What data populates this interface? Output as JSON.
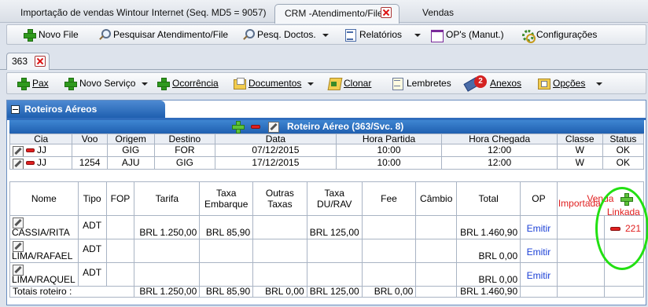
{
  "main_tabs": [
    {
      "label": "Importação de vendas Wintour Internet (Seq. MD5 = 9057)"
    },
    {
      "label": "CRM -Atendimento/File"
    },
    {
      "label": "Vendas"
    }
  ],
  "toolbar1": {
    "novo_file": "Novo File",
    "pesquisar": "Pesquisar Atendimento/File",
    "pesq_doctos": "Pesq. Doctos.",
    "relatorios": "Relatórios",
    "ops": "OP's (Manut.)",
    "configuracoes": "Configurações"
  },
  "inner_tab": {
    "label": "363"
  },
  "toolbar2": {
    "pax": "Pax",
    "novo_servico": "Novo Serviço",
    "ocorrencia": "Ocorrência",
    "documentos": "Documentos",
    "clonar": "Clonar",
    "lembretes": "Lembretes",
    "anexos": "Anexos",
    "anexos_count": "2",
    "opcoes": "Opções"
  },
  "panel": {
    "title": "Roteiros Aéreos",
    "section_title": "Roteiro Aéreo (363/Svc. 8)"
  },
  "flights": {
    "headers": [
      "Cia",
      "Voo",
      "Origem",
      "Destino",
      "Data",
      "Hora Partida",
      "Hora Chegada",
      "Classe",
      "Status"
    ],
    "rows": [
      {
        "cia": "JJ",
        "voo": "",
        "origem": "GIG",
        "destino": "FOR",
        "data": "07/12/2015",
        "partida": "10:00",
        "chegada": "12:00",
        "classe": "W",
        "status": "OK"
      },
      {
        "cia": "JJ",
        "voo": "1254",
        "origem": "AJU",
        "destino": "GIG",
        "data": "17/12/2015",
        "partida": "10:00",
        "chegada": "12:00",
        "classe": "W",
        "status": "OK"
      }
    ]
  },
  "fares": {
    "headers": {
      "nome": "Nome",
      "tipo": "Tipo",
      "fop": "FOP",
      "tarifa": "Tarifa",
      "taxa_embarque_1": "Taxa",
      "taxa_embarque_2": "Embarque",
      "outras_taxas_1": "Outras",
      "outras_taxas_2": "Taxas",
      "taxa_du_1": "Taxa",
      "taxa_du_2": "DU/RAV",
      "fee": "Fee",
      "cambio": "Câmbio",
      "total": "Total",
      "op": "OP",
      "venda": "Venda",
      "importada": "Importada",
      "linkada": "Linkada"
    },
    "rows": [
      {
        "nome": "CASSIA/RITA",
        "tipo": "ADT",
        "fop": "",
        "tarifa": "BRL 1.250,00",
        "taxa_embarque": "BRL 85,90",
        "outras_taxas": "",
        "taxa_du": "BRL 125,00",
        "fee": "",
        "cambio": "",
        "total": "BRL 1.460,90",
        "op": "Emitir",
        "importada": "",
        "linkada": "221"
      },
      {
        "nome": "LIMA/RAFAEL",
        "tipo": "ADT",
        "fop": "",
        "tarifa": "",
        "taxa_embarque": "",
        "outras_taxas": "",
        "taxa_du": "",
        "fee": "",
        "cambio": "",
        "total": "BRL 0,00",
        "op": "Emitir",
        "importada": "",
        "linkada": ""
      },
      {
        "nome": "LIMA/RAQUEL",
        "tipo": "ADT",
        "fop": "",
        "tarifa": "",
        "taxa_embarque": "",
        "outras_taxas": "",
        "taxa_du": "",
        "fee": "",
        "cambio": "",
        "total": "BRL 0,00",
        "op": "Emitir",
        "importada": "",
        "linkada": ""
      }
    ],
    "totals": {
      "label": "Totais roteiro :",
      "tarifa": "BRL 1.250,00",
      "taxa_embarque": "BRL 85,90",
      "outras_taxas": "BRL 0,00",
      "taxa_du": "BRL 125,00",
      "fee": "BRL 0,00",
      "total": "BRL 1.460,90"
    }
  },
  "colors": {
    "header_blue": "#1f5fb0",
    "accent_red": "#e02020",
    "link_blue": "#1a3fd6",
    "highlight_green": "#22e012"
  }
}
